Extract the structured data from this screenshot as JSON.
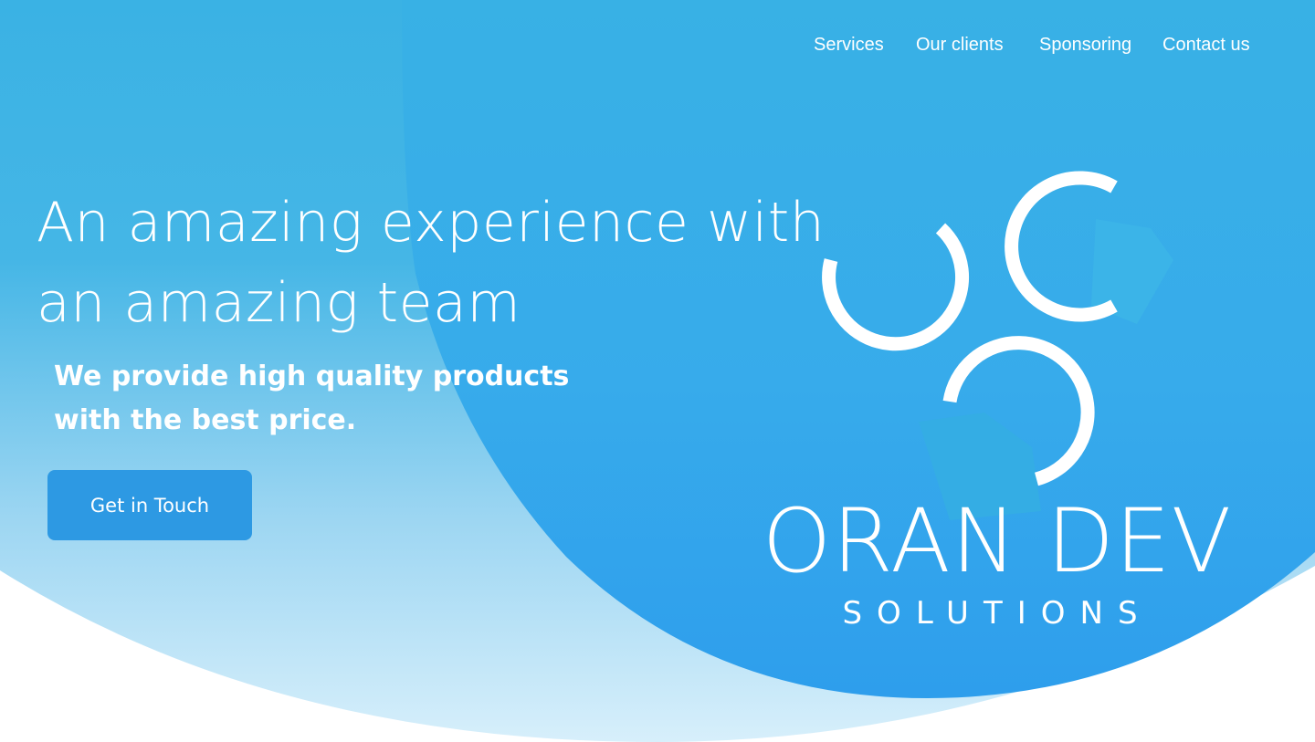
{
  "nav": {
    "items": [
      "Services",
      "Our clients",
      "Sponsoring",
      "Contact us"
    ]
  },
  "hero": {
    "headline_line1": "An amazing experience with",
    "headline_line2": "an amazing team",
    "subhead_line1": "We provide high quality products",
    "subhead_line2": "with the best price.",
    "cta_label": "Get in Touch"
  },
  "logo": {
    "title": "ORAN DEV",
    "subtitle": "SOLUTIONS",
    "icon": "three-rings-logo-icon"
  },
  "colors": {
    "primary_blue": "#38b2e6",
    "deep_blue": "#2fa0ec",
    "button_blue": "#2d99e3",
    "light_blue": "#d4eefb",
    "text": "#ffffff"
  }
}
